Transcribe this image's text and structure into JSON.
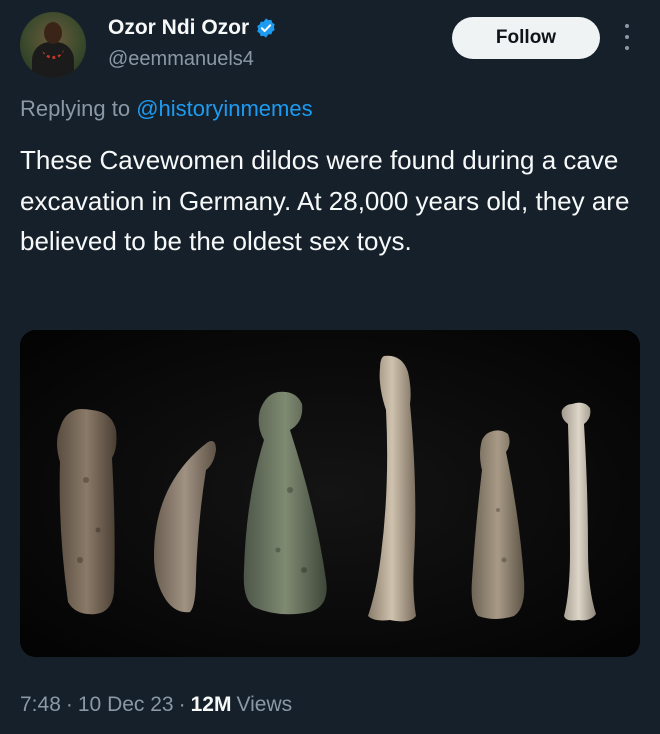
{
  "author": {
    "name": "Ozor Ndi Ozor",
    "handle": "@eemmanuels4",
    "verified": true
  },
  "follow_button": {
    "label": "Follow"
  },
  "reply": {
    "prefix": "Replying to",
    "mention": "@historyinmemes"
  },
  "tweet": {
    "text": "These Cavewomen dildos were found during a cave excavation in Germany. At 28,000 years old, they are believed to be the oldest sex toys."
  },
  "meta": {
    "time": "7:48",
    "sep1": "·",
    "date": "10 Dec 23",
    "sep2": "·",
    "views_count": "12M",
    "views_label": "Views"
  },
  "colors": {
    "background": "#15202b",
    "accent": "#1d9bf0",
    "secondary_text": "#8b98a5",
    "verified": "#1d9bf0"
  },
  "icons": {
    "verified": "verified-badge-icon",
    "more": "more-vertical-icon"
  }
}
